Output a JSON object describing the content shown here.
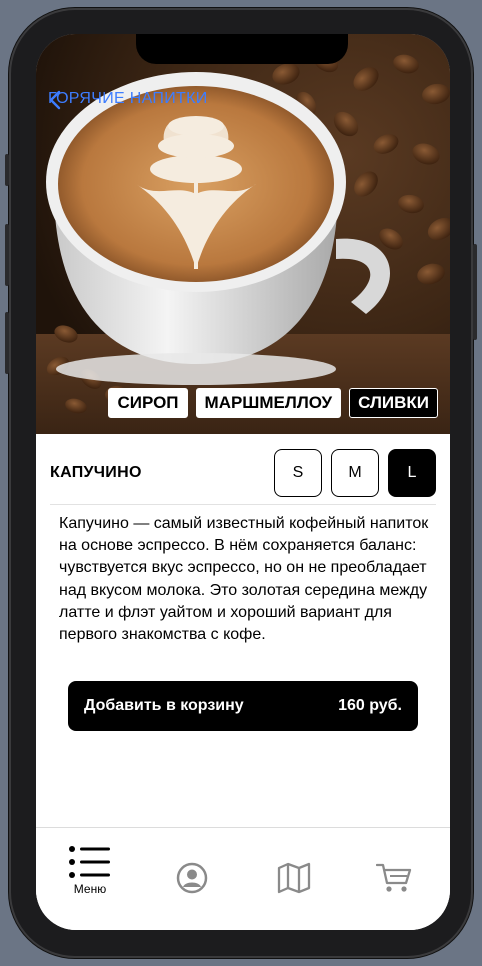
{
  "nav": {
    "back_label": "ГОРЯЧИЕ НАПИТКИ"
  },
  "addons": [
    {
      "label": "СИРОП",
      "selected": false
    },
    {
      "label": "МАРШМЕЛЛОУ",
      "selected": false
    },
    {
      "label": "СЛИВКИ",
      "selected": true
    }
  ],
  "product": {
    "name": "КАПУЧИНО",
    "sizes": [
      {
        "label": "S",
        "selected": false
      },
      {
        "label": "M",
        "selected": false
      },
      {
        "label": "L",
        "selected": true
      }
    ],
    "description": "Капучино — самый известный кофейный напиток на основе эспрессо. В нём сохраняется баланс: чувствуется вкус эспрессо, но он не преобладает над вкусом молока. Это золотая середина между латте и флэт уайтом и хороший вариант для первого знакомства с кофе."
  },
  "cart_button": {
    "label": "Добавить в корзину",
    "price": "160 руб."
  },
  "tabbar": {
    "items": [
      {
        "label": "Меню",
        "icon": "menu-list-icon",
        "active": true
      },
      {
        "label": "",
        "icon": "profile-icon",
        "active": false
      },
      {
        "label": "",
        "icon": "map-icon",
        "active": false
      },
      {
        "label": "",
        "icon": "cart-icon",
        "active": false
      }
    ]
  },
  "colors": {
    "accent": "#3d7dff",
    "primary": "#000000",
    "background": "#ffffff"
  }
}
